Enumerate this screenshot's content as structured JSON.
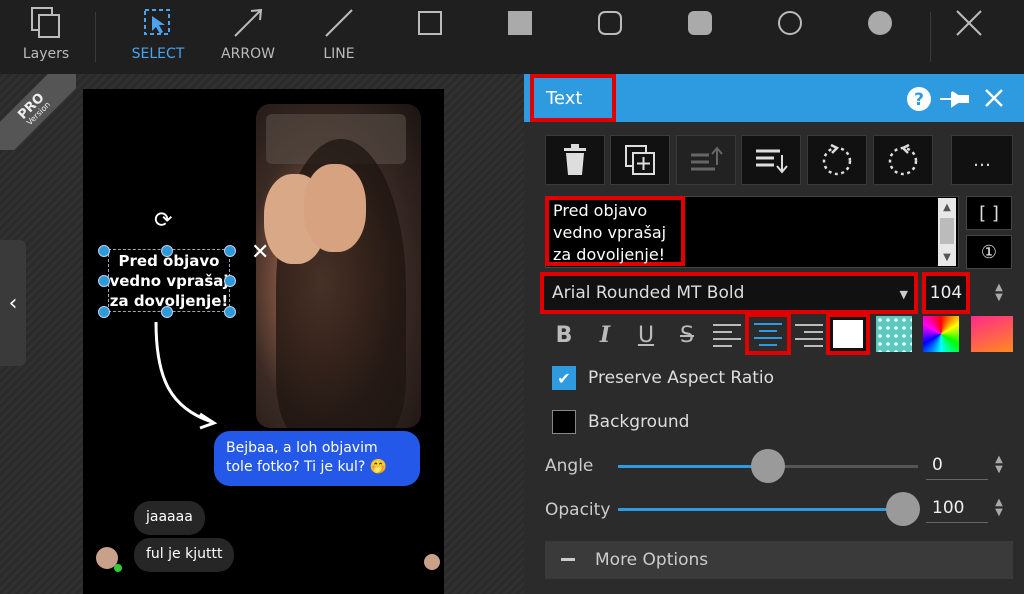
{
  "toolbar": {
    "tools": [
      {
        "id": "layers",
        "label": "Layers",
        "icon": "layers-icon"
      },
      {
        "id": "select",
        "label": "SELECT",
        "icon": "select-icon"
      },
      {
        "id": "arrow",
        "label": "ARROW",
        "icon": "arrow-icon"
      },
      {
        "id": "line",
        "label": "LINE",
        "icon": "line-icon"
      }
    ],
    "shapes": [
      "rect-outline-icon",
      "rect-filled-icon",
      "rounded-rect-outline-icon",
      "rounded-rect-filled-icon",
      "circle-outline-icon",
      "circle-filled-icon"
    ],
    "close_icon": "close-icon"
  },
  "badge": {
    "line1": "PRO",
    "line2": "Version"
  },
  "canvas": {
    "overlay_text": "Pred objavo\nvedno vprašaj\nza dovoljenje!",
    "blue_bubble": "Bejbaa, a loh objavim tole fotko? Ti je kul? 🤭",
    "gray_bubble_1": "jaaaaa",
    "gray_bubble_2": "ful je kjuttt"
  },
  "panel": {
    "title": "Text",
    "text_value": "Pred objavo\nvedno vprašaj\nza dovoljenje!",
    "font": "Arial Rounded MT Bold",
    "font_size": "104",
    "more_button": "…",
    "bracket_button": "[ ]",
    "numbered_button": "①",
    "preserve_aspect_ratio": {
      "label": "Preserve Aspect Ratio",
      "checked": true
    },
    "background": {
      "label": "Background",
      "checked": false
    },
    "angle": {
      "label": "Angle",
      "value": "0",
      "fraction": 0.5
    },
    "opacity": {
      "label": "Opacity",
      "value": "100",
      "fraction": 1.0
    },
    "more_options": "More Options",
    "colors": {
      "accent": "#2e9ae0",
      "highlight": "#e00000",
      "text_color": "#ffffff"
    }
  }
}
